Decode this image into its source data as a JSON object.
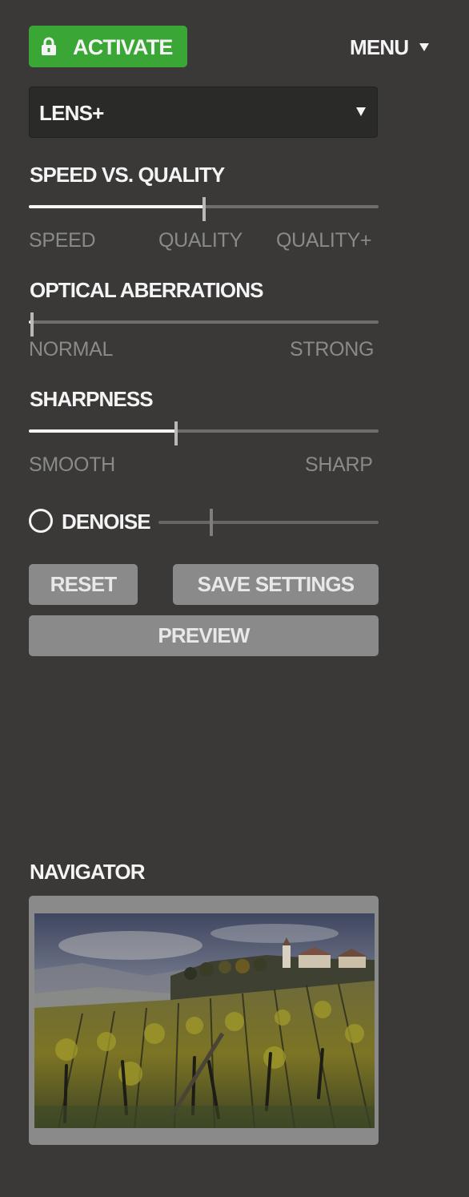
{
  "header": {
    "activate_label": "ACTIVATE",
    "menu_label": "MENU"
  },
  "lens_select": {
    "value": "LENS+"
  },
  "speed_quality": {
    "title": "SPEED VS. QUALITY",
    "labels": [
      "SPEED",
      "QUALITY",
      "QUALITY+"
    ],
    "value": 0.5
  },
  "optical_aberrations": {
    "title": "OPTICAL ABERRATIONS",
    "labels": [
      "NORMAL",
      "STRONG"
    ],
    "value": 0.01
  },
  "sharpness": {
    "title": "SHARPNESS",
    "labels": [
      "SMOOTH",
      "SHARP"
    ],
    "value": 0.42
  },
  "denoise": {
    "label": "DENOISE",
    "enabled": false,
    "value": 0.24
  },
  "buttons": {
    "reset": "RESET",
    "save": "SAVE SETTINGS",
    "preview": "PREVIEW"
  },
  "navigator": {
    "title": "NAVIGATOR"
  },
  "colors": {
    "background": "#3a3938",
    "accent_green": "#3aa635",
    "button_gray": "#8a8a8a"
  },
  "icons": [
    "lock-icon",
    "chevron-down-icon"
  ]
}
